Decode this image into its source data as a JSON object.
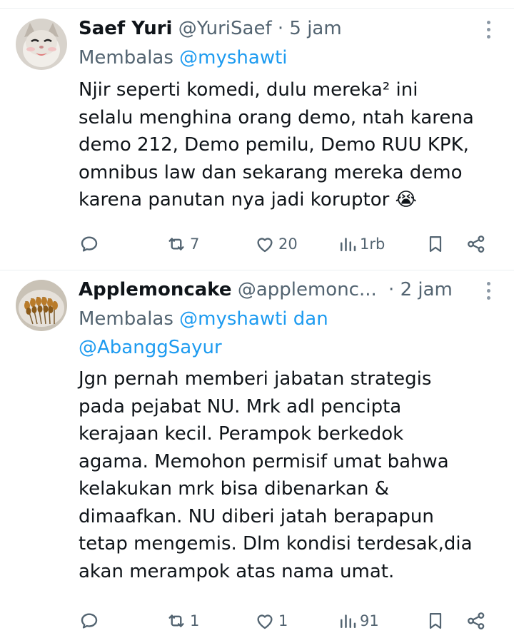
{
  "tweets": [
    {
      "name": "Saef Yuri",
      "handle": "@YuriSaef",
      "dot": "·",
      "time": "5 jam",
      "reply_prefix": "Membalas",
      "reply_line1": "@myshawti",
      "reply_line2": "",
      "body_lines": [
        "Njir seperti komedi, dulu mereka² ini",
        "selalu menghina orang demo, ntah karena",
        "demo 212, Demo pemilu, Demo RUU KPK,",
        "omnibus law dan sekarang mereka demo",
        "karena panutan nya jadi koruptor 😭"
      ],
      "replies": "",
      "retweets": "7",
      "likes": "20",
      "views": "1rb"
    },
    {
      "name": "Applemoncake",
      "handle": "@applemonc...",
      "dot": "·",
      "time": "2 jam",
      "reply_prefix": "Membalas",
      "reply_line1": "@myshawti dan",
      "reply_line2": "@AbanggSayur",
      "body_lines": [
        "Jgn pernah memberi jabatan strategis",
        "pada pejabat NU. Mrk adl pencipta",
        "kerajaan kecil. Perampok berkedok",
        "agama. Memohon permisif umat bahwa",
        "kelakukan mrk bisa dibenarkan &",
        "dimaafkan. NU diberi jatah berapapun",
        "tetap mengemis. Dlm kondisi terdesak,dia",
        "akan merampok atas nama umat."
      ],
      "replies": "",
      "retweets": "1",
      "likes": "1",
      "views": "91"
    }
  ],
  "icons": {
    "reply": "reply-icon",
    "retweet": "retweet-icon",
    "like": "heart-icon",
    "views": "views-icon",
    "bookmark": "bookmark-icon",
    "share": "share-icon",
    "more": "more-icon"
  },
  "colors": {
    "text": "#0f1419",
    "secondary": "#536471",
    "link": "#1d9bf0",
    "divider": "#eceff1"
  }
}
